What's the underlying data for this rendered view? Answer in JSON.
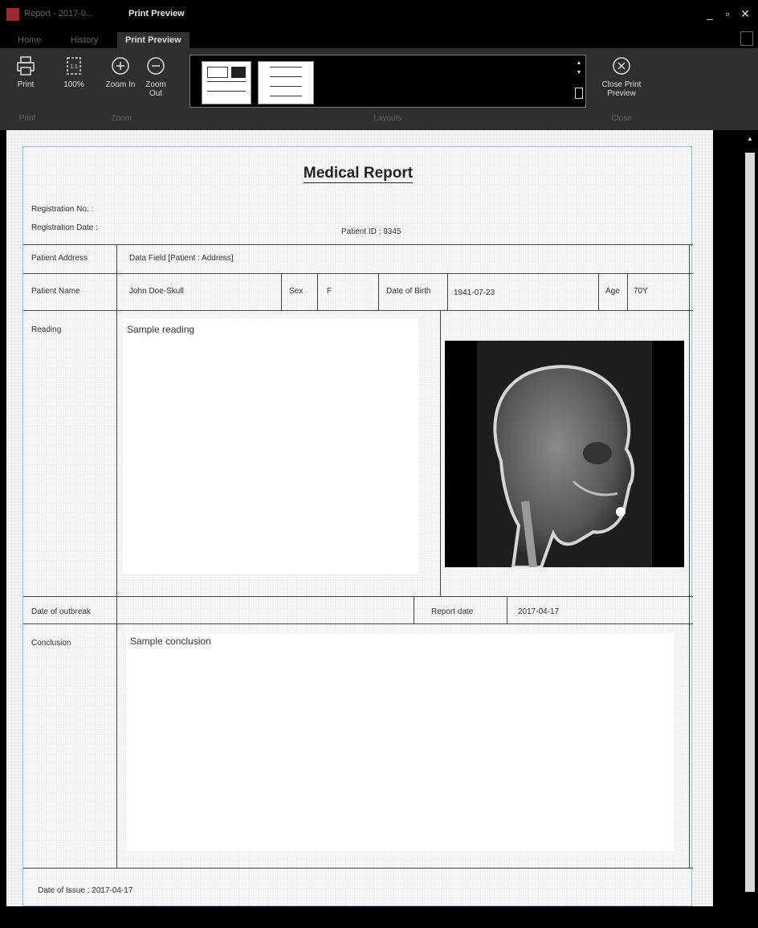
{
  "window": {
    "title": "Report - 2017-0...",
    "context_title": "Print Preview"
  },
  "tabs": [
    {
      "label": "Home"
    },
    {
      "label": "History"
    },
    {
      "label": "Print Preview",
      "active": true
    }
  ],
  "ribbon": {
    "buttons": {
      "print": "Print",
      "zoom100": "100%",
      "zoom_in": "Zoom In",
      "zoom_out": "Zoom Out",
      "close_preview": "Close Print Preview"
    },
    "groups": {
      "print": "Print",
      "zoom": "Zoom",
      "layouts": "Layouts",
      "close": "Close"
    }
  },
  "report": {
    "title": "Medical Report",
    "registration_no_label": "Registration No. :",
    "registration_date_label": "Registration Date :",
    "patient_id": "Patient ID : 9345",
    "patient_address_label": "Patient Address",
    "patient_address_value": "Data Field [Patient : Address]",
    "patient_name_label": "Patient Name",
    "patient_name_value": "John Doe-Skull",
    "sex_label": "Sex",
    "sex_value": "F",
    "dob_label": "Date of Birth",
    "dob_value": "1941-07-23",
    "age_label": "Age",
    "age_value": "70Y",
    "reading_label": "Reading",
    "reading_value": "Sample reading",
    "outbreak_label": "Date of outbreak",
    "report_date_label": "Report date",
    "report_date_value": "2017-04-17",
    "conclusion_label": "Conclusion",
    "conclusion_value": "Sample conclusion",
    "issue_date": "Date of Issue : 2017-04-17"
  },
  "colors": {
    "app_icon": "#a0282e",
    "ribbon_bg": "#2f2f2f",
    "page_border": "#9bbbd6"
  }
}
